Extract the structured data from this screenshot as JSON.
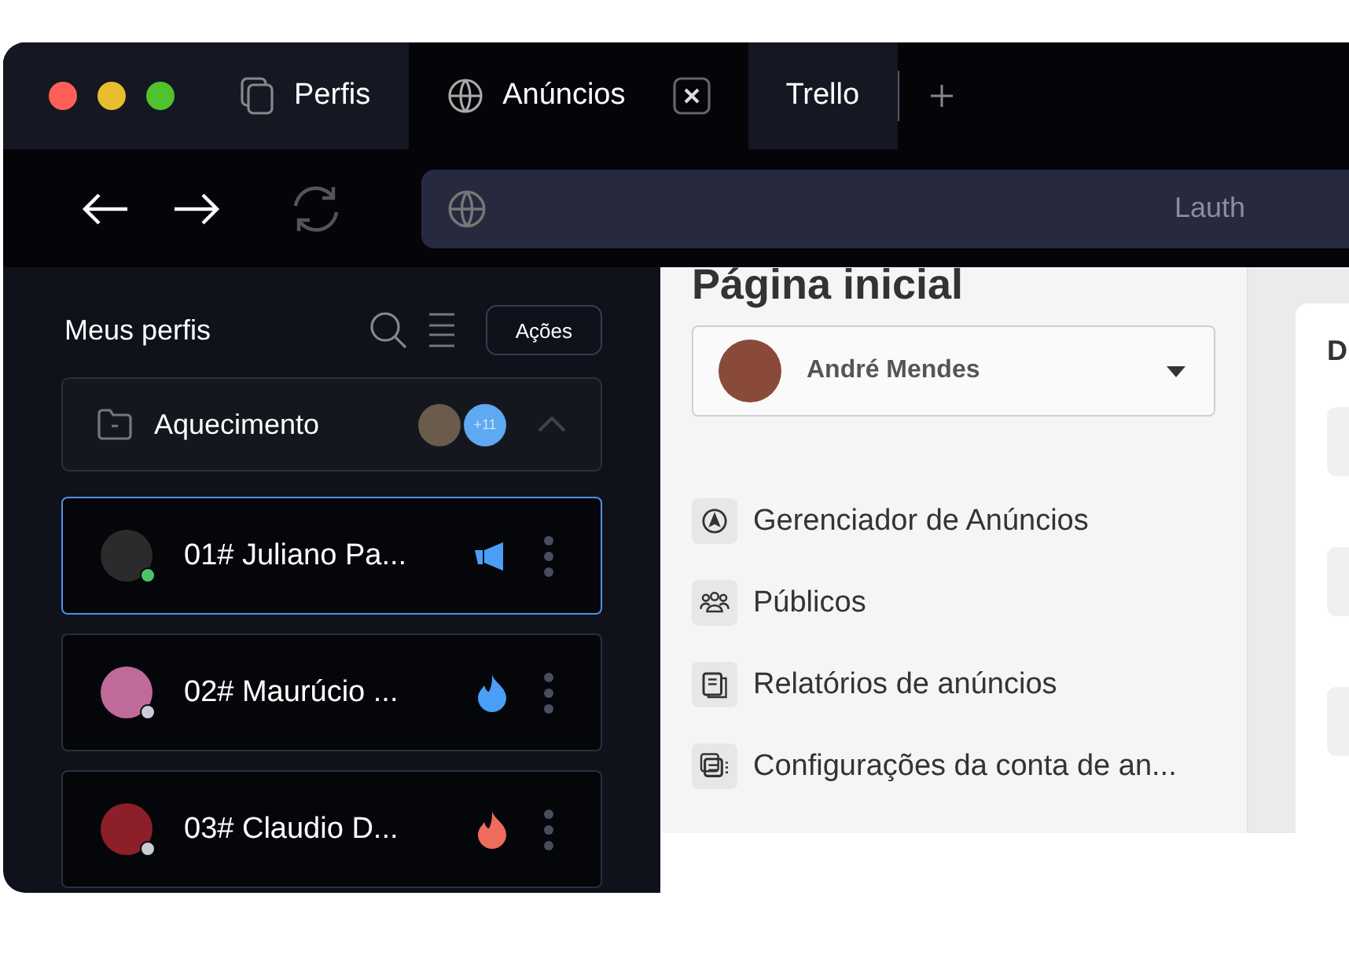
{
  "tabs": [
    {
      "label": "Perfis",
      "kind": "pages",
      "selected": false,
      "closable": false
    },
    {
      "label": "Anúncios",
      "kind": "globe",
      "selected": true,
      "closable": true
    },
    {
      "label": "Trello",
      "kind": "plain",
      "selected": false,
      "closable": false
    }
  ],
  "address_bar": {
    "value": "Lauth"
  },
  "sidebar": {
    "title": "Meus perfis",
    "actions_button": "Ações",
    "group": {
      "name": "Aquecimento",
      "extra_count": "+11",
      "expanded": true
    },
    "profiles": [
      {
        "name": "01# Juliano Pa...",
        "selected": true,
        "status": {
          "color": "#4cc36a"
        },
        "badge": {
          "kind": "megaphone",
          "color": "#4b9ef5"
        }
      },
      {
        "name": "02# Maurúcio ...",
        "selected": false,
        "status": {
          "color": "#c9ccd6"
        },
        "badge": {
          "kind": "flame",
          "color": "#4b9ef5"
        }
      },
      {
        "name": "03# Claudio D...",
        "selected": false,
        "status": {
          "color": "#c9ccd6"
        },
        "badge": {
          "kind": "flame",
          "color": "#ef6b5b"
        }
      }
    ]
  },
  "webpage": {
    "heading": "Página inicial",
    "account_select": {
      "value": "André Mendes"
    },
    "menu": [
      {
        "kind": "compass",
        "label": "Gerenciador de Anúncios"
      },
      {
        "kind": "people",
        "label": "Públicos"
      },
      {
        "kind": "report",
        "label": "Relatórios de anúncios"
      },
      {
        "kind": "settings",
        "label": "Configurações da conta de an..."
      }
    ],
    "right_card": {
      "title": "D"
    }
  }
}
